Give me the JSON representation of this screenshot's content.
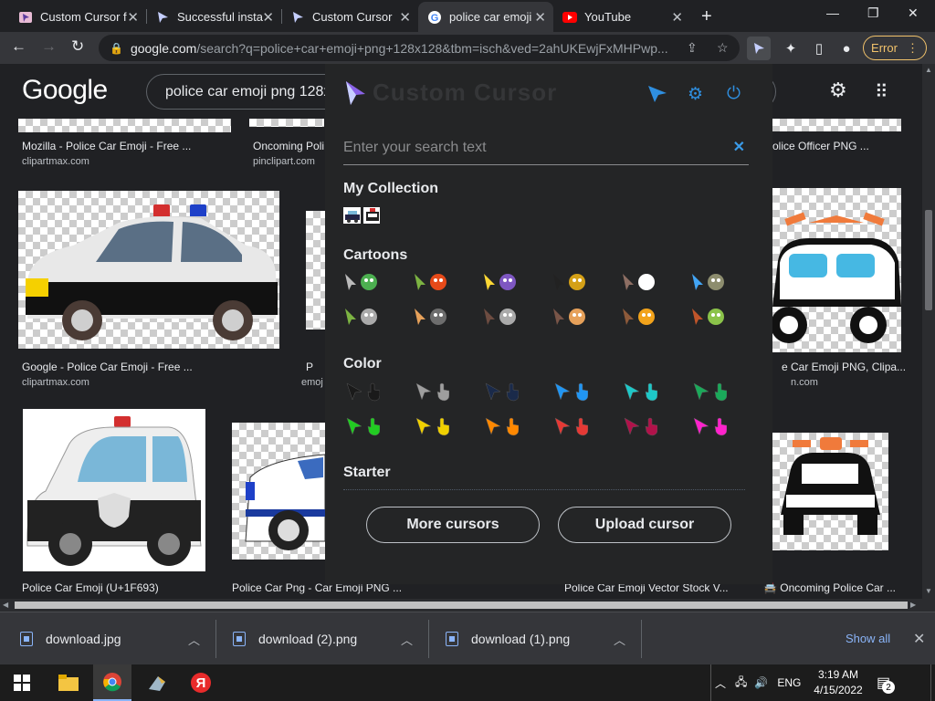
{
  "tabs": [
    {
      "title": "Custom Cursor f",
      "icon": "custom-cursor-favicon"
    },
    {
      "title": "Successful insta",
      "icon": "custom-cursor-favicon"
    },
    {
      "title": "Custom Cursor",
      "icon": "custom-cursor-favicon"
    },
    {
      "title": "police car emoji",
      "icon": "google-favicon",
      "active": true
    },
    {
      "title": "YouTube",
      "icon": "youtube-favicon"
    }
  ],
  "address": {
    "host": "google.com",
    "path": "/search?q=police+car+emoji+png+128x128&tbm=isch&ved=2ahUKEwjFxMHPwp..."
  },
  "toolbar": {
    "error_label": "Error"
  },
  "google": {
    "logo": "Google",
    "query": "police car emoji png 128x128"
  },
  "results": [
    {
      "title": "Mozilla - Police Car Emoji - Free ...",
      "source": "clipartmax.com"
    },
    {
      "title": "Oncoming Poli",
      "source": "pinclipart.com"
    },
    {
      "title": "olice Officer PNG ...",
      "source": ""
    },
    {
      "title": "Google - Police Car Emoji - Free ...",
      "source": "clipartmax.com"
    },
    {
      "title": "P",
      "source": "emoj"
    },
    {
      "title": "e Car Emoji PNG, Clipa...",
      "source": "n.com"
    },
    {
      "title": "Police Car Emoji (U+1F693)",
      "source": ""
    },
    {
      "title": "Police Car Png - Car Emoji PNG ...",
      "source": ""
    },
    {
      "title": "Police Car Emoji Vector Stock V...",
      "source": ""
    },
    {
      "title": "Oncoming Police Car ...",
      "source": ""
    }
  ],
  "popup": {
    "logo_text": "Custom Cursor",
    "search_placeholder": "Enter your search text",
    "sections": {
      "collection": "My Collection",
      "cartoons": "Cartoons",
      "color": "Color",
      "starter": "Starter"
    },
    "more_button": "More cursors",
    "upload_button": "Upload cursor",
    "color_cursors": [
      "#1a1a1a",
      "#9e9e9e",
      "#1a2a4a",
      "#2196f3",
      "#1ec8c8",
      "#1aaa5a",
      "#22cc22",
      "#f0d000",
      "#ff8800",
      "#e53935",
      "#b0124a",
      "#ff22cc"
    ]
  },
  "downloads": [
    {
      "name": "download.jpg"
    },
    {
      "name": "download (2).png"
    },
    {
      "name": "download (1).png"
    }
  ],
  "downloads_show_all": "Show all",
  "taskbar": {
    "lang": "ENG",
    "time": "3:19 AM",
    "date": "4/15/2022",
    "notifications": "2"
  }
}
